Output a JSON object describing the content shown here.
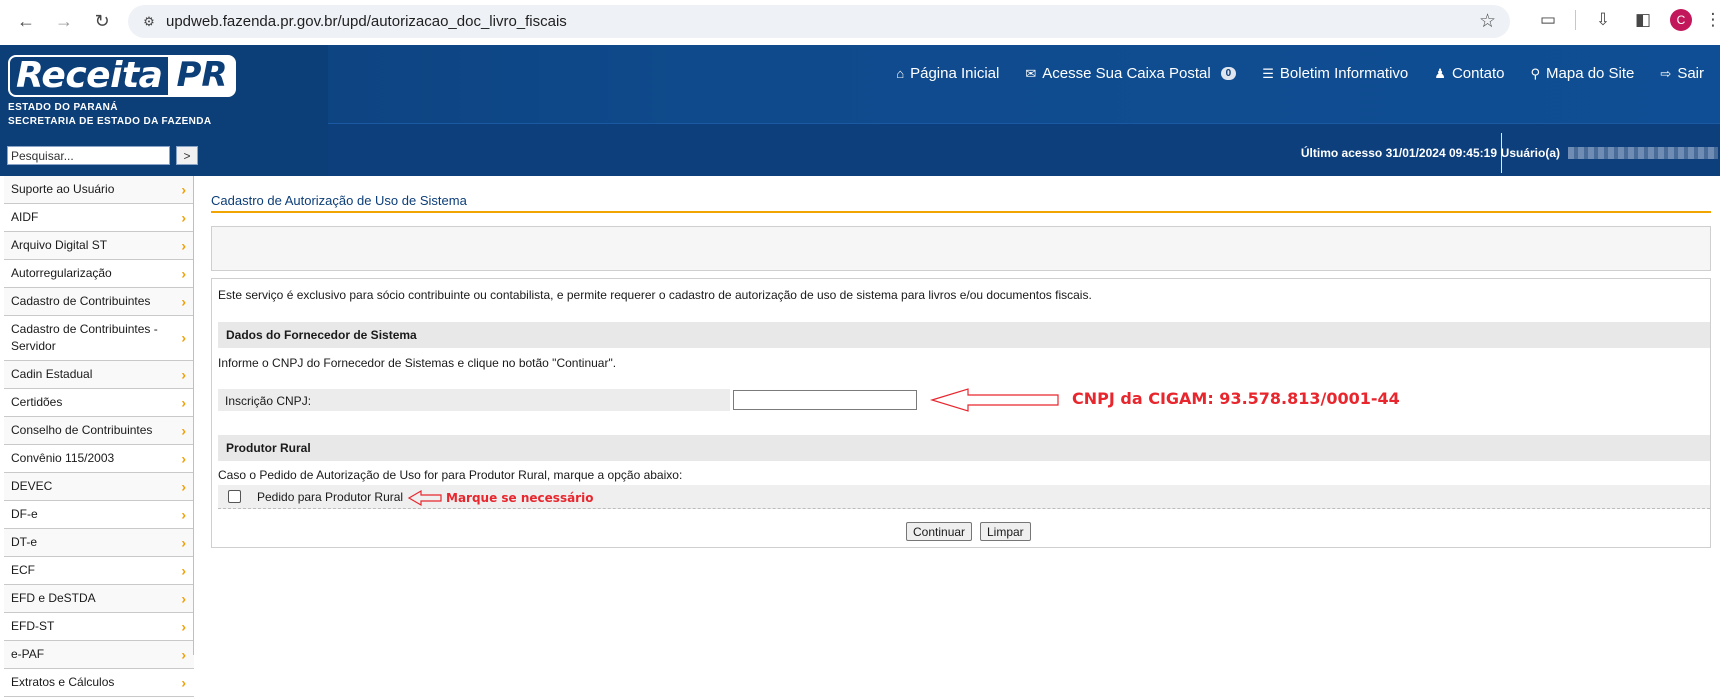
{
  "browser": {
    "url": "updweb.fazenda.pr.gov.br/upd/autorizacao_doc_livro_fiscais",
    "avatar_initial": "C"
  },
  "header": {
    "logo_main": "Receita",
    "logo_pr": "PR",
    "logo_sub_line1": "ESTADO DO PARANÁ",
    "logo_sub_line2": "SECRETARIA DE ESTADO DA FAZENDA",
    "search_placeholder": "Pesquisar...",
    "search_button": ">",
    "nav": {
      "home": "Página Inicial",
      "mailbox": "Acesse Sua Caixa Postal",
      "mailbox_count": "0",
      "bulletin": "Boletim Informativo",
      "contact": "Contato",
      "sitemap": "Mapa do Site",
      "logout": "Sair"
    },
    "last_access": "Último acesso 31/01/2024 09:45:19",
    "user_label": "Usuário(a)"
  },
  "sidebar": {
    "items": [
      "Suporte ao Usuário",
      "AIDF",
      "Arquivo Digital ST",
      "Autorregularização",
      "Cadastro de Contribuintes",
      "Cadastro de Contribuintes - Servidor",
      "Cadin Estadual",
      "Certidões",
      "Conselho de Contribuintes",
      "Convênio 115/2003",
      "DEVEC",
      "DF-e",
      "DT-e",
      "ECF",
      "EFD e DeSTDA",
      "EFD-ST",
      "e-PAF",
      "Extratos e Cálculos"
    ]
  },
  "main": {
    "title": "Cadastro de Autorização de Uso de Sistema",
    "intro": "Este serviço é exclusivo para sócio contribuinte ou contabilista, e permite requerer o cadastro de autorização de uso de sistema para livros e/ou documentos fiscais.",
    "supplier_section": "Dados do Fornecedor de Sistema",
    "supplier_instruction": "Informe o CNPJ do Fornecedor de Sistemas e clique no botão \"Continuar\".",
    "cnpj_label": "Inscrição CNPJ:",
    "cnpj_value": "",
    "rural_section": "Produtor Rural",
    "rural_instruction": "Caso o Pedido de Autorização de Uso for para Produtor Rural, marque a opção abaixo:",
    "rural_checkbox_label": "Pedido para Produtor Rural",
    "btn_continue": "Continuar",
    "btn_clear": "Limpar"
  },
  "annotations": {
    "cnpj_note": "CNPJ da CIGAM: 93.578.813/0001-44",
    "rural_note": "Marque se necessário",
    "color": "#e8262e"
  }
}
